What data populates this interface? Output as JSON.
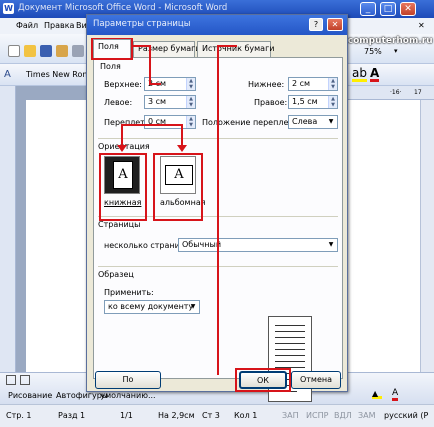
{
  "word": {
    "title": "Документ Microsoft Office Word - Microsoft Word",
    "menu": [
      "Файл",
      "Правка",
      "Вид"
    ],
    "font_name": "Times New Rom",
    "zoom": "75%",
    "watermark": "www.computerhom.ru",
    "drawing_label": "Рисование",
    "autoshapes_label": "Автофигуры",
    "status": {
      "page": "Стр. 1",
      "section": "Разд 1",
      "pages": "1/1",
      "at": "На 2,9см",
      "line": "Ст 3",
      "col": "Кол 1",
      "rec": "ЗАП",
      "trk": "ИСПР",
      "ext": "ВДЛ",
      "ovr": "ЗАМ",
      "lang": "русский (Р"
    }
  },
  "dialog": {
    "title": "Параметры страницы",
    "help": "?",
    "close": "✕",
    "tabs": [
      "Поля",
      "Размер бумаги",
      "Источник бумаги"
    ],
    "fields_section": "Поля",
    "top_label": "Верхнее:",
    "top_value": "2 см",
    "bottom_label": "Нижнее:",
    "bottom_value": "2 см",
    "left_label": "Левое:",
    "left_value": "3 см",
    "right_label": "Правое:",
    "right_value": "1,5 см",
    "gutter_label": "Переплет:",
    "gutter_value": "0 см",
    "gutter_pos_label": "Положение переплета:",
    "gutter_pos_value": "Слева",
    "orientation_section": "Ориентация",
    "portrait_label": "книжная",
    "landscape_label": "альбомная",
    "pages_section": "Страницы",
    "multiple_label": "несколько страниц:",
    "multiple_value": "Обычный",
    "sample_section": "Образец",
    "apply_label": "Применить:",
    "apply_value": "ко всему документу",
    "default_button": "По умолчанию...",
    "ok_button": "ОК",
    "cancel_button": "Отмена"
  },
  "colors": {
    "highlight": "#d7141a",
    "title_blue": "#2456c6",
    "dialog_bg": "#ece9d8"
  }
}
